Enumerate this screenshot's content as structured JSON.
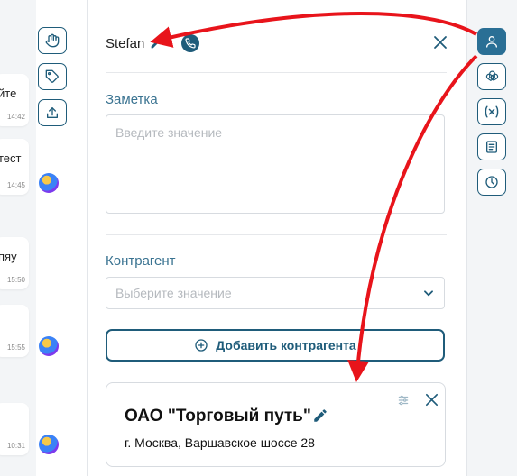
{
  "chat": {
    "messages": [
      {
        "text": "йте",
        "time": "14:42"
      },
      {
        "text": "тест",
        "time": "14:45"
      },
      {
        "text": "пяу",
        "time": "15:50"
      },
      {
        "text": "",
        "time": "15:55"
      },
      {
        "text": "",
        "time": "10:31"
      }
    ]
  },
  "contact": {
    "name": "Stefan"
  },
  "note": {
    "label": "Заметка",
    "placeholder": "Введите значение"
  },
  "counterparty": {
    "label": "Контрагент",
    "placeholder": "Выберите значение",
    "add_label": "Добавить контрагента"
  },
  "card": {
    "title": "ОАО \"Торговый путь\"",
    "address": "г. Москва, Варшавское шоссе 28"
  },
  "colors": {
    "accent": "#1f5c7a",
    "label": "#3a7391",
    "arrow": "#e8141b"
  },
  "icons": {
    "column_tools": [
      "hand-icon",
      "tag-icon",
      "upload-icon"
    ],
    "right_bar": [
      "user-icon",
      "openai-icon",
      "variable-icon",
      "document-icon",
      "clock-icon"
    ]
  }
}
